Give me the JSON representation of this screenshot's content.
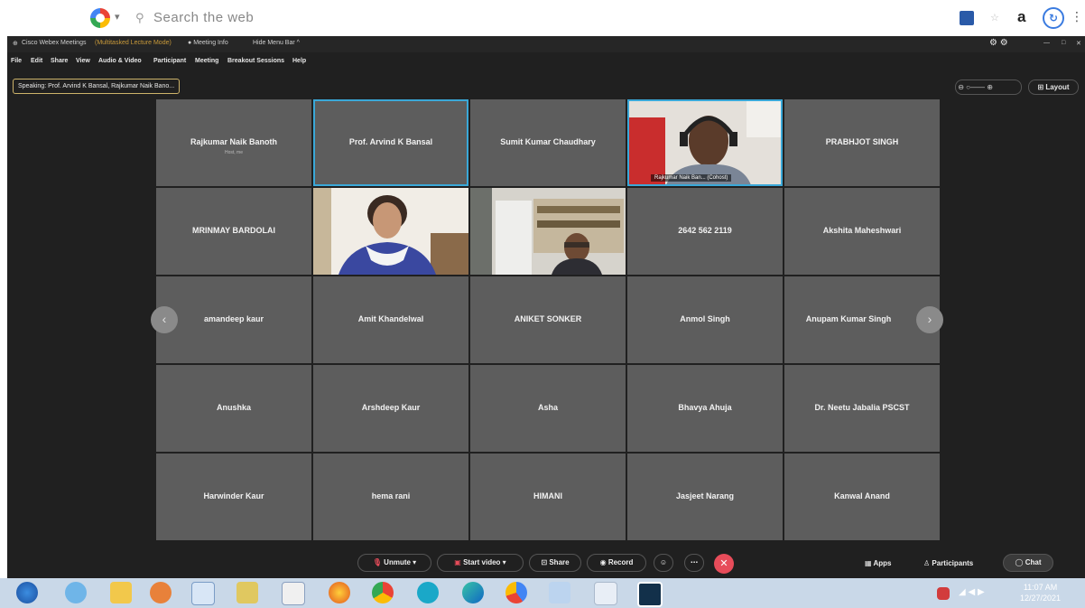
{
  "browser": {
    "search_text": "Search the web",
    "profile_letter": "a"
  },
  "window": {
    "title": "Cisco Webex Meetings",
    "mode": "(Multitasked Lecture Mode)",
    "meeting_info": "Meeting Info",
    "hide_menu": "Hide Menu Bar ^"
  },
  "menu": [
    "File",
    "Edit",
    "Share",
    "View",
    "Audio & Video",
    "Participant",
    "Meeting",
    "Breakout Sessions",
    "Help"
  ],
  "speaking": "Speaking: Prof. Arvind K Bansal, Rajkumar Naik Bano...",
  "layout_label": "Layout",
  "tiles": [
    {
      "name": "Rajkumar Naik Banoth",
      "sub": "Host, me"
    },
    {
      "name": "Prof. Arvind K Bansal",
      "active": true
    },
    {
      "name": "Sumit Kumar Chaudhary"
    },
    {
      "video": "man-headset",
      "label": "Rajkumar Naik Ban... (Cohost)",
      "active": true
    },
    {
      "name": "PRABHJOT SINGH"
    },
    {
      "name": "MRINMAY BARDOLAI"
    },
    {
      "video": "woman"
    },
    {
      "video": "man-office"
    },
    {
      "name": "2642 562 2119"
    },
    {
      "name": "Akshita Maheshwari"
    },
    {
      "name": "amandeep kaur"
    },
    {
      "name": "Amit Khandelwal"
    },
    {
      "name": "ANIKET SONKER"
    },
    {
      "name": "Anmol Singh"
    },
    {
      "name": "Anupam Kumar Singh"
    },
    {
      "name": "Anushka"
    },
    {
      "name": "Arshdeep Kaur"
    },
    {
      "name": "Asha"
    },
    {
      "name": "Bhavya Ahuja"
    },
    {
      "name": "Dr. Neetu Jabalia PSCST"
    },
    {
      "name": "Harwinder Kaur"
    },
    {
      "name": "hema rani"
    },
    {
      "name": "HIMANI"
    },
    {
      "name": "Jasjeet Narang"
    },
    {
      "name": "Kanwal Anand"
    }
  ],
  "controls": {
    "unmute": "Unmute",
    "start_video": "Start video",
    "share": "Share",
    "record": "Record",
    "apps": "Apps",
    "participants": "Participants",
    "chat": "Chat"
  },
  "clock": {
    "time": "11:07 AM",
    "date": "12/27/2021"
  },
  "colors": {
    "active_border": "#3aa8d8",
    "end_button": "#e74c5a",
    "tile": "#5d5d5d"
  }
}
